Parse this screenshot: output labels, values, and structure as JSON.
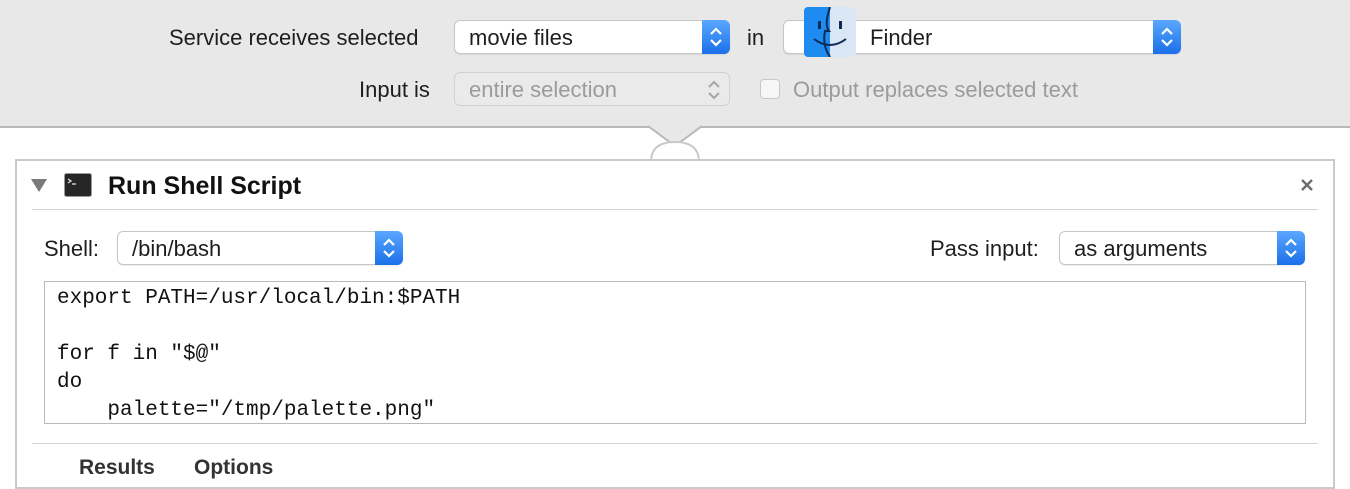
{
  "service_bar": {
    "receives_label": "Service receives selected",
    "receives_value": "movie files",
    "in_label": "in",
    "app_value": "Finder",
    "input_is_label": "Input is",
    "input_is_value": "entire selection",
    "output_replaces_label": "Output replaces selected text",
    "output_replaces_checked": false
  },
  "action": {
    "title": "Run Shell Script",
    "shell_label": "Shell:",
    "shell_value": "/bin/bash",
    "pass_input_label": "Pass input:",
    "pass_input_value": "as arguments",
    "script_lines": [
      "export PATH=/usr/local/bin:$PATH",
      "",
      "for f in \"$@\"",
      "do",
      "    palette=\"/tmp/palette.png\""
    ],
    "tabs": [
      "Results",
      "Options"
    ]
  },
  "colors": {
    "accent": "#1b6fe8",
    "toolbar_bg": "#e8e8e8"
  },
  "icons": {
    "finder": "finder-icon",
    "terminal": "terminal-icon",
    "close": "close-icon",
    "disclosure": "disclosure-triangle-icon"
  }
}
